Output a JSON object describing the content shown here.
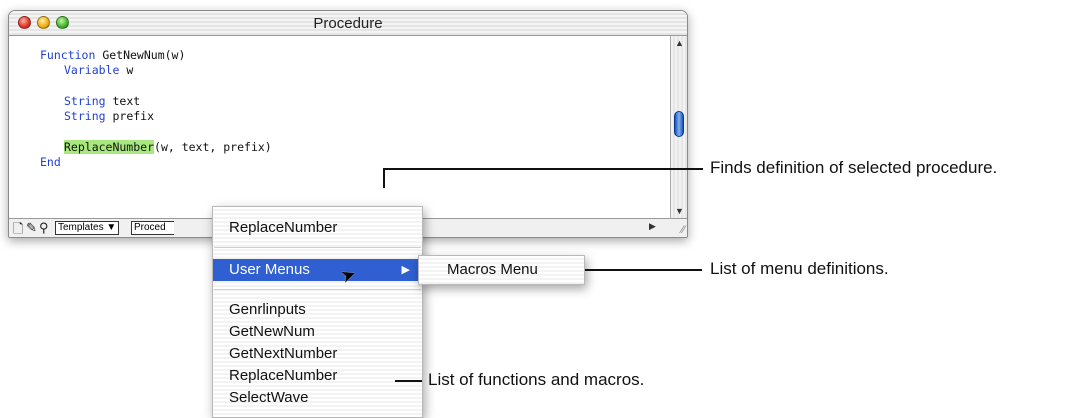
{
  "window": {
    "title": "Procedure",
    "code": {
      "line1_kw": "Function",
      "line1_rest": " GetNewNum(w)",
      "line2_kw": "Variable",
      "line2_rest": " w",
      "line3_kw": "String",
      "line3_rest": " text",
      "line4_kw": "String",
      "line4_rest": " prefix",
      "line5_hl": "ReplaceNumber",
      "line5_rest": "(w, text, prefix)",
      "line6_kw": "End"
    },
    "statusbar": {
      "templates_label": "Templates ▼",
      "procedure_label": "Proced"
    }
  },
  "popup_menu": {
    "top_item": "ReplaceNumber",
    "user_menus": "User Menus",
    "items": [
      "Genrlinputs",
      "GetNewNum",
      "GetNextNumber",
      "ReplaceNumber",
      "SelectWave"
    ]
  },
  "submenu": {
    "item": "Macros Menu"
  },
  "callouts": {
    "finds_definition": "Finds definition of selected procedure.",
    "menu_definitions": "List of menu definitions.",
    "functions_macros": "List of functions and macros."
  },
  "colors": {
    "keyword": "#1f3fd6",
    "highlight": "#a8e87e",
    "menu_selection": "#2f5fd0"
  }
}
